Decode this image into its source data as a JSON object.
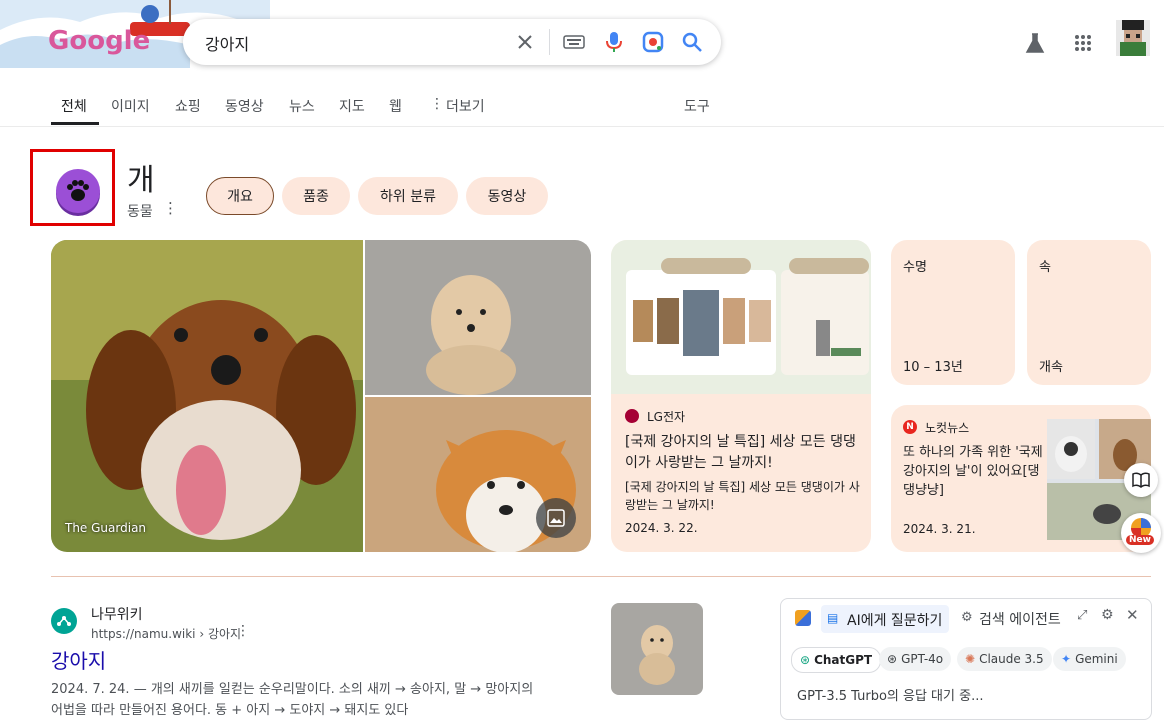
{
  "header": {
    "logo_text": "Google",
    "search_query": "강아지",
    "colors": {
      "accent": "#4285f4",
      "chip_bg": "#fde7dc",
      "card_bg": "#fde9dd"
    }
  },
  "tabs": [
    "전체",
    "이미지",
    "쇼핑",
    "동영상",
    "뉴스",
    "지도",
    "웹",
    "더보기",
    "도구"
  ],
  "entity": {
    "title": "개",
    "subtitle": "동물",
    "chips": [
      "개요",
      "품종",
      "하위 분류",
      "동영상"
    ]
  },
  "images": {
    "credit": "The Guardian"
  },
  "news1": {
    "source": "LG전자",
    "title": "[국제 강아지의 날 특집] 세상 모든 댕댕이가 사랑받는 그 날까지!",
    "snippet": "[국제 강아지의 날 특집] 세상 모든 댕댕이가 사랑받는 그 날까지!",
    "date": "2024. 3. 22."
  },
  "facts": [
    {
      "label": "수명",
      "value": "10 – 13년"
    },
    {
      "label": "속",
      "value": "개속"
    }
  ],
  "news2": {
    "source": "노컷뉴스",
    "title": "또 하나의 가족 위한 '국제 강아지의 날'이 있어요[댕댕냥냥]",
    "date": "2024. 3. 21."
  },
  "result": {
    "site_name": "나무위키",
    "url": "https://namu.wiki › 강아지",
    "title": "강아지",
    "snippet_line1": "2024. 7. 24. — 개의 새끼를 일컫는 순우리말이다. 소의 새끼 → 송아지, 말 → 망아지의",
    "snippet_line2": "어법을 따라 만들어진 용어다. 동 + 아지 → 도야지 → 돼지도 있다"
  },
  "ai_panel": {
    "tab1": "AI에게 질문하기",
    "tab2": "검색 에이전트",
    "models": [
      "ChatGPT",
      "GPT-4o",
      "Claude 3.5",
      "Gemini"
    ],
    "status": "GPT-3.5 Turbo의 응답 대기 중..."
  },
  "side": {
    "new_badge": "New"
  }
}
